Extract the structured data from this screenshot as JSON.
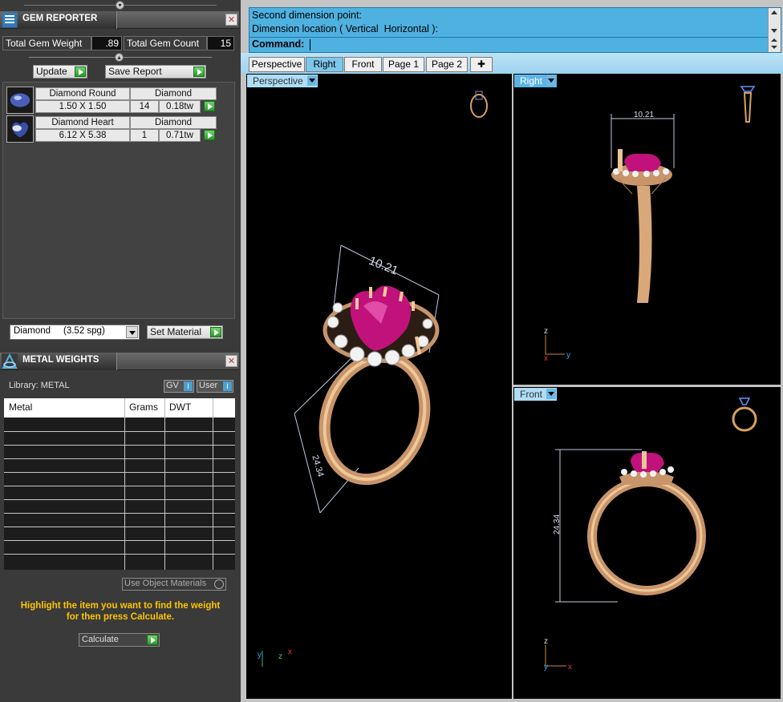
{
  "gem_reporter": {
    "title": "GEM REPORTER",
    "total_weight_label": "Total Gem Weight",
    "total_weight_value": ".89",
    "total_count_label": "Total Gem Count",
    "total_count_value": "15",
    "update_label": "Update",
    "save_report_label": "Save Report",
    "gems": [
      {
        "name": "Diamond Round",
        "material": "Diamond",
        "size": "1.50 X 1.50",
        "count": "14",
        "weight": "0.18tw"
      },
      {
        "name": "Diamond Heart",
        "material": "Diamond",
        "size": "6.12 X 5.38",
        "count": "1",
        "weight": "0.71tw"
      }
    ],
    "material_select": "Diamond     (3.52 spg)",
    "set_material_label": "Set Material"
  },
  "metal_weights": {
    "title": "METAL WEIGHTS",
    "library_label": "Library: METAL",
    "gv_label": "GV",
    "user_label": "User",
    "columns": [
      "Metal",
      "Grams",
      "DWT"
    ],
    "use_object_materials_label": "Use Object Materials",
    "hint_line1": "Highlight the item you want to find the weight",
    "hint_line2": "for then press Calculate.",
    "calculate_label": "Calculate"
  },
  "command": {
    "line1": "Second dimension point:",
    "line2": "Dimension location ( Vertical  Horizontal ):",
    "prompt_label": "Command:"
  },
  "tabs": [
    "Perspective",
    "Right",
    "Front",
    "Page 1",
    "Page 2"
  ],
  "viewports": {
    "perspective": {
      "label": "Perspective",
      "dim_width": "10.21",
      "dim_height": "24.34"
    },
    "right": {
      "label": "Right",
      "dim_width": "10.21"
    },
    "front": {
      "label": "Front",
      "dim_height": "24.34"
    }
  },
  "colors": {
    "accent_blue": "#4fb1e0",
    "ruby": "#c0127a",
    "gold": "#d8a878",
    "hint_yellow": "#ffc400"
  }
}
